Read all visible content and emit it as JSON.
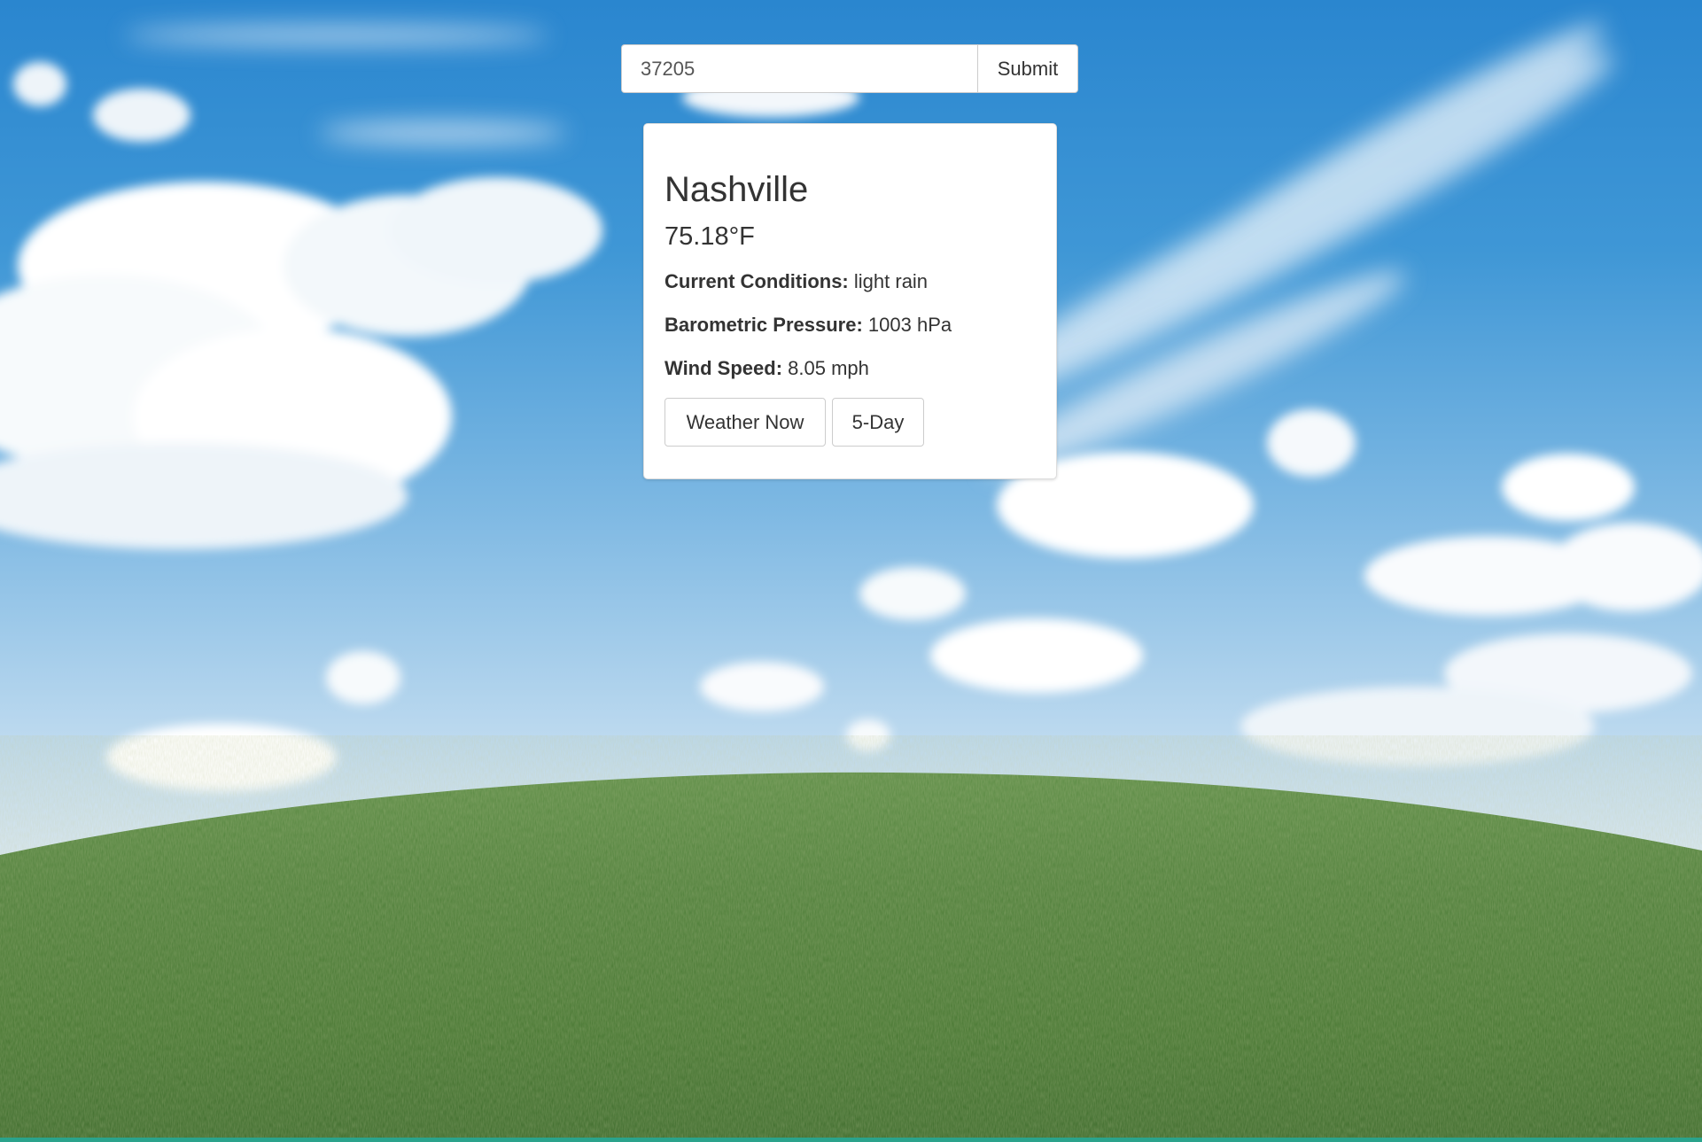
{
  "search": {
    "value": "37205",
    "submit_label": "Submit"
  },
  "weather": {
    "city": "Nashville",
    "temperature": "75.18°F",
    "conditions_label": "Current Conditions:",
    "conditions_value": "light rain",
    "pressure_label": "Barometric Pressure:",
    "pressure_value": "1003 hPa",
    "wind_label": "Wind Speed:",
    "wind_value": "8.05 mph"
  },
  "buttons": {
    "now_label": "Weather Now",
    "five_day_label": "5-Day"
  },
  "colors": {
    "sky": "#3f97d6",
    "grass": "#4f7f3a",
    "card_background": "#ffffff"
  }
}
